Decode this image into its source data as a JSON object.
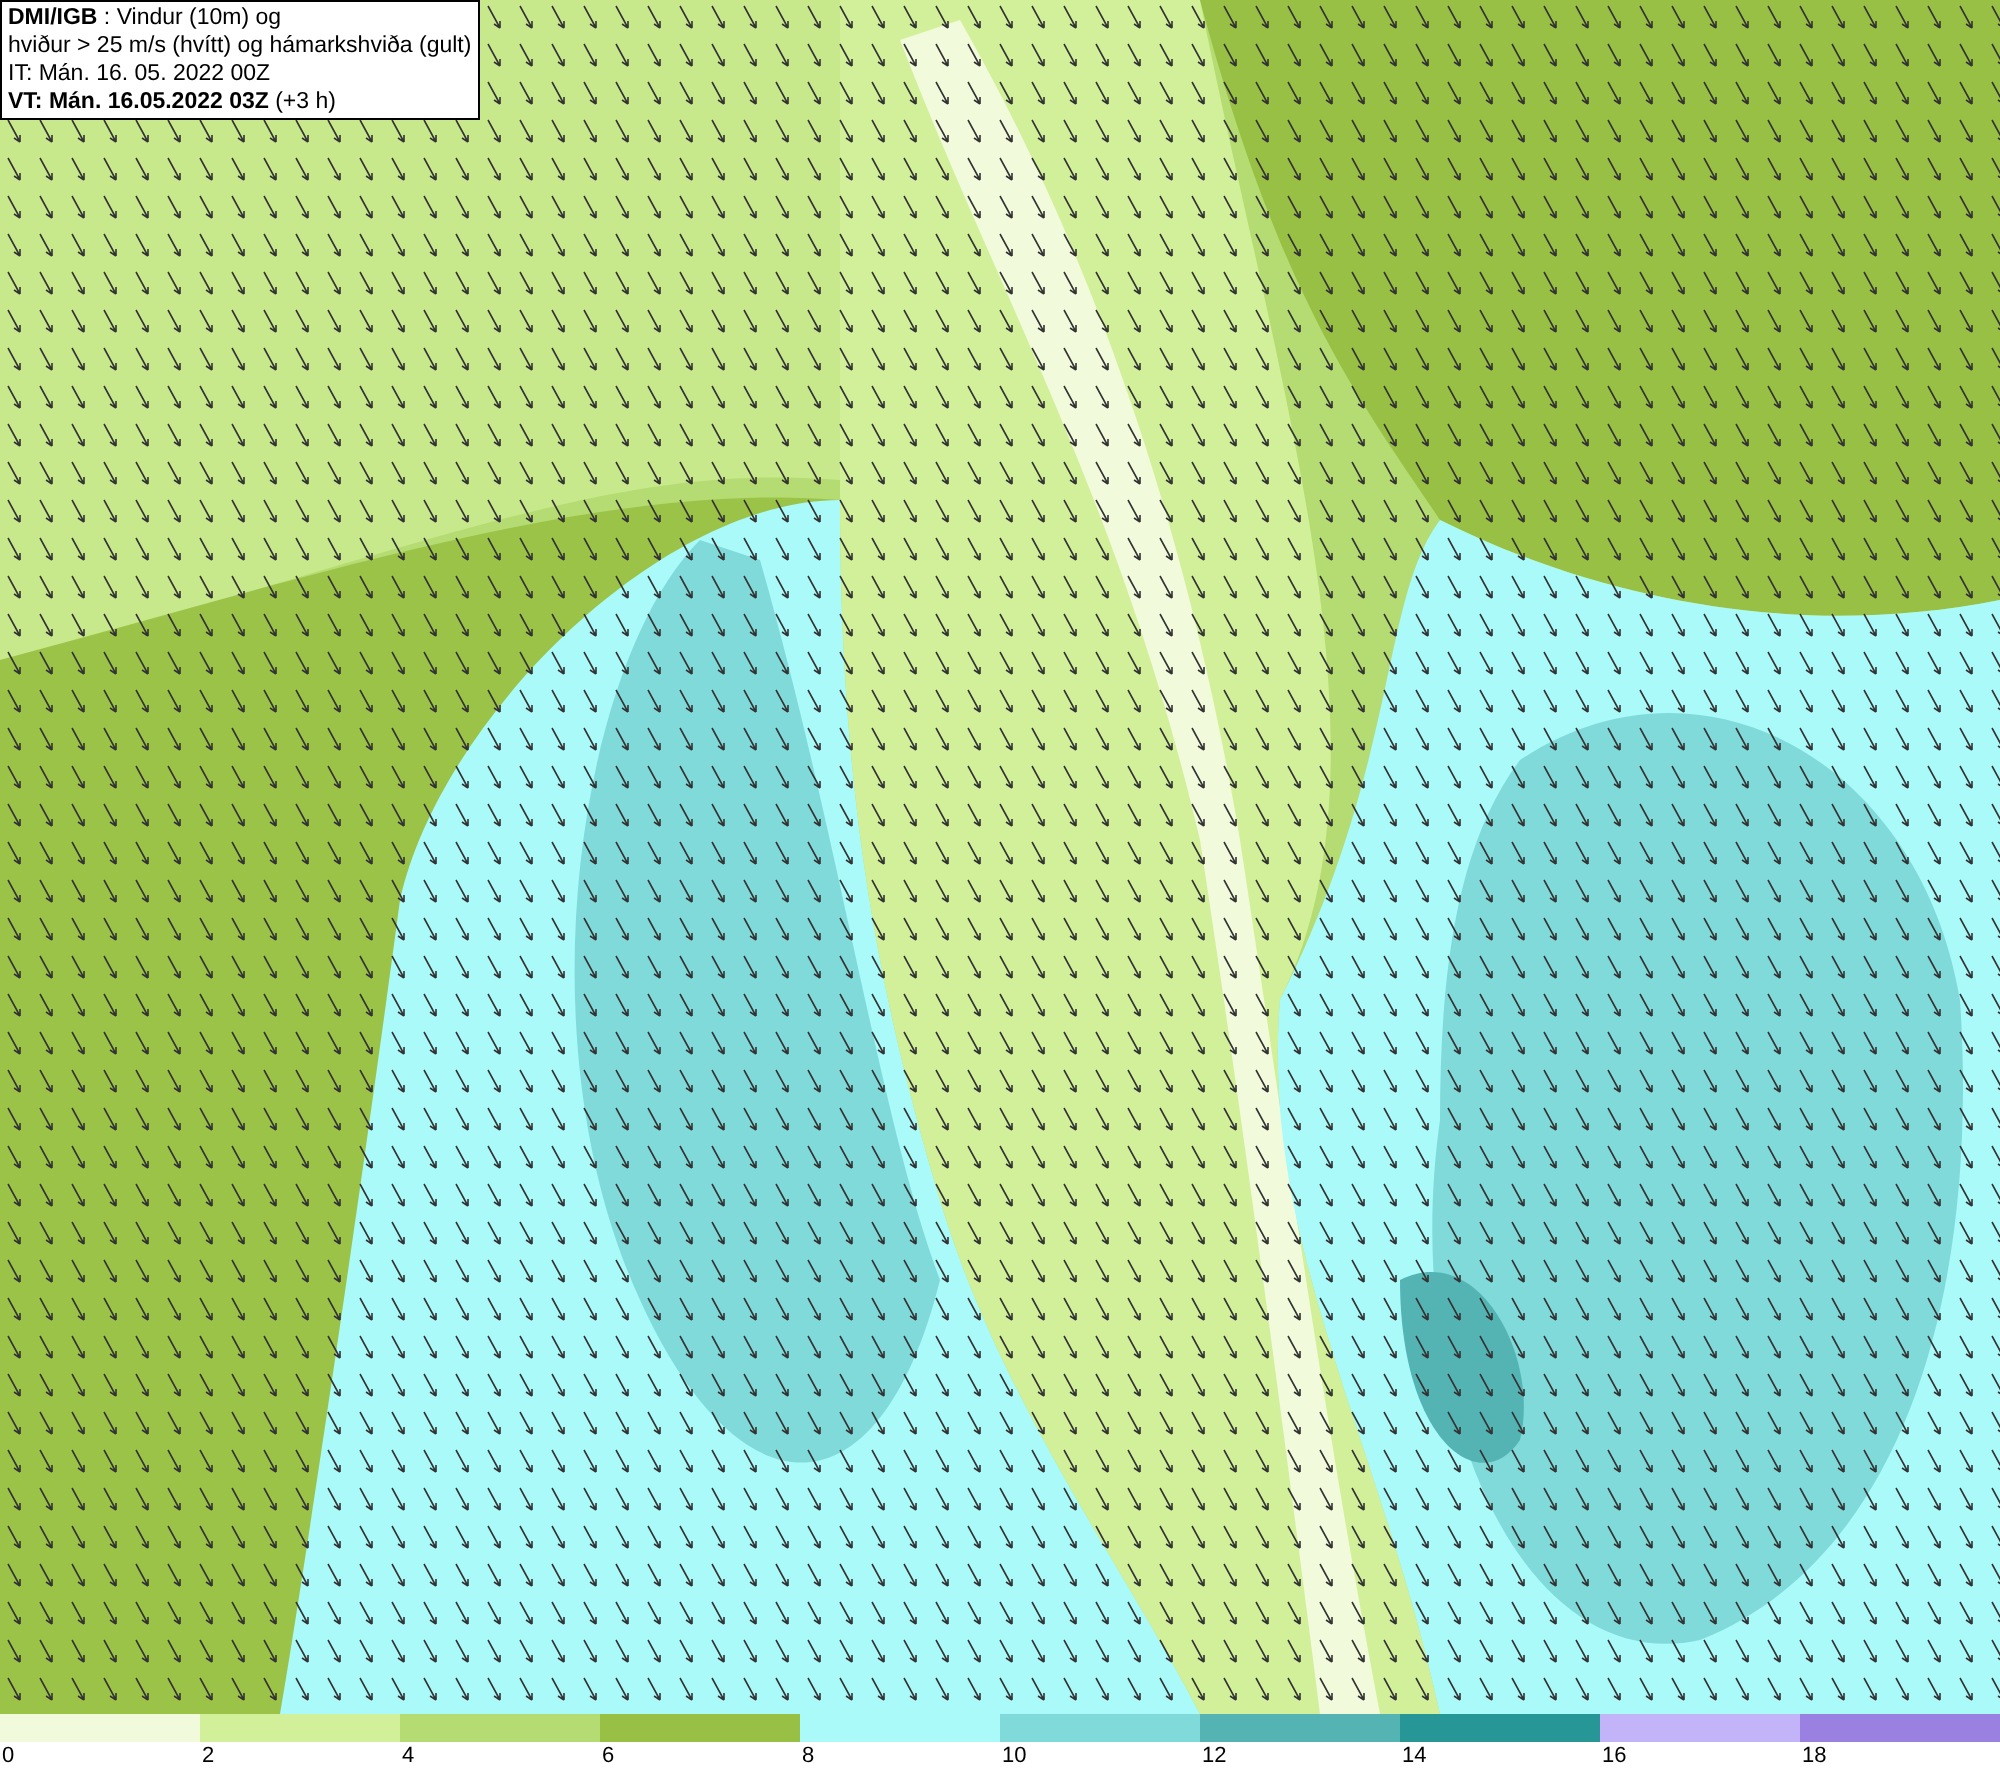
{
  "header": {
    "lines": [
      "**DMI/IGB** : Vindur (10m) og",
      "hviður > 25 m/s (hvítt) og hámarkshviða (gult)",
      "IT: Mán. 16. 05. 2022 00Z",
      "**VT: Mán. 16.05.2022 03Z** (+3 h)"
    ]
  },
  "legend": [
    {
      "label": "0",
      "color": "#f2fadc"
    },
    {
      "label": "2",
      "color": "#d2f09a"
    },
    {
      "label": "4",
      "color": "#b4dc72"
    },
    {
      "label": "6",
      "color": "#98c044"
    },
    {
      "label": "8",
      "color": "#aafafa"
    },
    {
      "label": "10",
      "color": "#80dada"
    },
    {
      "label": "12",
      "color": "#54b4b4"
    },
    {
      "label": "14",
      "color": "#269696"
    },
    {
      "label": "16",
      "color": "#c3b3f8"
    },
    {
      "label": "18",
      "color": "#9a80e0"
    }
  ]
}
